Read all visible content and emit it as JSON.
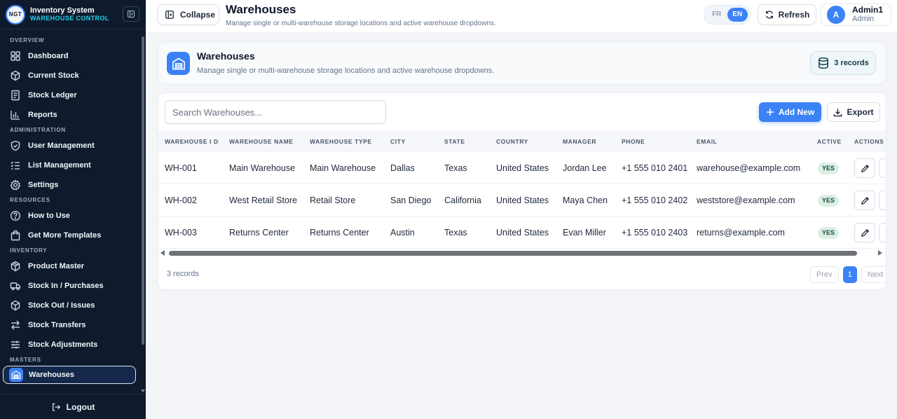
{
  "sidebar": {
    "logo_text": "NGT",
    "brand_title": "Inventory System",
    "brand_subtitle": "WAREHOUSE CONTROL",
    "sections": {
      "overview": "OVERVIEW",
      "administration": "ADMINISTRATION",
      "resources": "RESOURCES",
      "inventory": "INVENTORY",
      "masters": "MASTERS"
    },
    "items": {
      "dashboard": "Dashboard",
      "current_stock": "Current Stock",
      "stock_ledger": "Stock Ledger",
      "reports": "Reports",
      "user_management": "User Management",
      "list_management": "List Management",
      "settings": "Settings",
      "how_to_use": "How to Use",
      "get_more_templates": "Get More Templates",
      "product_master": "Product Master",
      "stock_in": "Stock In / Purchases",
      "stock_out": "Stock Out / Issues",
      "stock_transfers": "Stock Transfers",
      "stock_adjustments": "Stock Adjustments",
      "warehouses": "Warehouses"
    },
    "logout": "Logout"
  },
  "topbar": {
    "collapse_label": "Collapse",
    "title": "Warehouses",
    "subtitle": "Manage single or multi-warehouse storage locations and active warehouse dropdowns.",
    "lang_fr": "FR",
    "lang_en": "EN",
    "refresh_label": "Refresh",
    "user_initial": "A",
    "user_name": "Admin1",
    "user_role": "Admin"
  },
  "header_card": {
    "title": "Warehouses",
    "subtitle": "Manage single or multi-warehouse storage locations and active warehouse dropdowns.",
    "records": "3 records"
  },
  "table": {
    "search_placeholder": "Search Warehouses...",
    "add_label": "Add New",
    "export_label": "Export",
    "columns": {
      "id": "WAREHOUSE I D",
      "name": "WAREHOUSE NAME",
      "type": "WAREHOUSE TYPE",
      "city": "CITY",
      "state": "STATE",
      "country": "COUNTRY",
      "manager": "MANAGER",
      "phone": "PHONE",
      "email": "EMAIL",
      "active": "ACTIVE",
      "actions": "ACTIONS"
    },
    "rows": [
      {
        "id": "WH-001",
        "name": "Main Warehouse",
        "type": "Main Warehouse",
        "city": "Dallas",
        "state": "Texas",
        "country": "United States",
        "manager": "Jordan Lee",
        "phone": "+1 555 010 2401",
        "email": "warehouse@example.com",
        "active": "YES",
        "extra": "1"
      },
      {
        "id": "WH-002",
        "name": "West Retail Store",
        "type": "Retail Store",
        "city": "San Diego",
        "state": "California",
        "country": "United States",
        "manager": "Maya Chen",
        "phone": "+1 555 010 2402",
        "email": "weststore@example.com",
        "active": "YES",
        "extra": "1"
      },
      {
        "id": "WH-003",
        "name": "Returns Center",
        "type": "Returns Center",
        "city": "Austin",
        "state": "Texas",
        "country": "United States",
        "manager": "Evan Miller",
        "phone": "+1 555 010 2403",
        "email": "returns@example.com",
        "active": "YES",
        "extra": "1"
      }
    ],
    "footer_count": "3 records",
    "pager": {
      "prev": "Prev",
      "current": "1",
      "next": "Next"
    }
  },
  "colors": {
    "sidebar_bg": "#0f1b2d",
    "accent": "#3b82f6",
    "brand_sub": "#22d3ee",
    "badge_bg": "#dcefe6"
  }
}
